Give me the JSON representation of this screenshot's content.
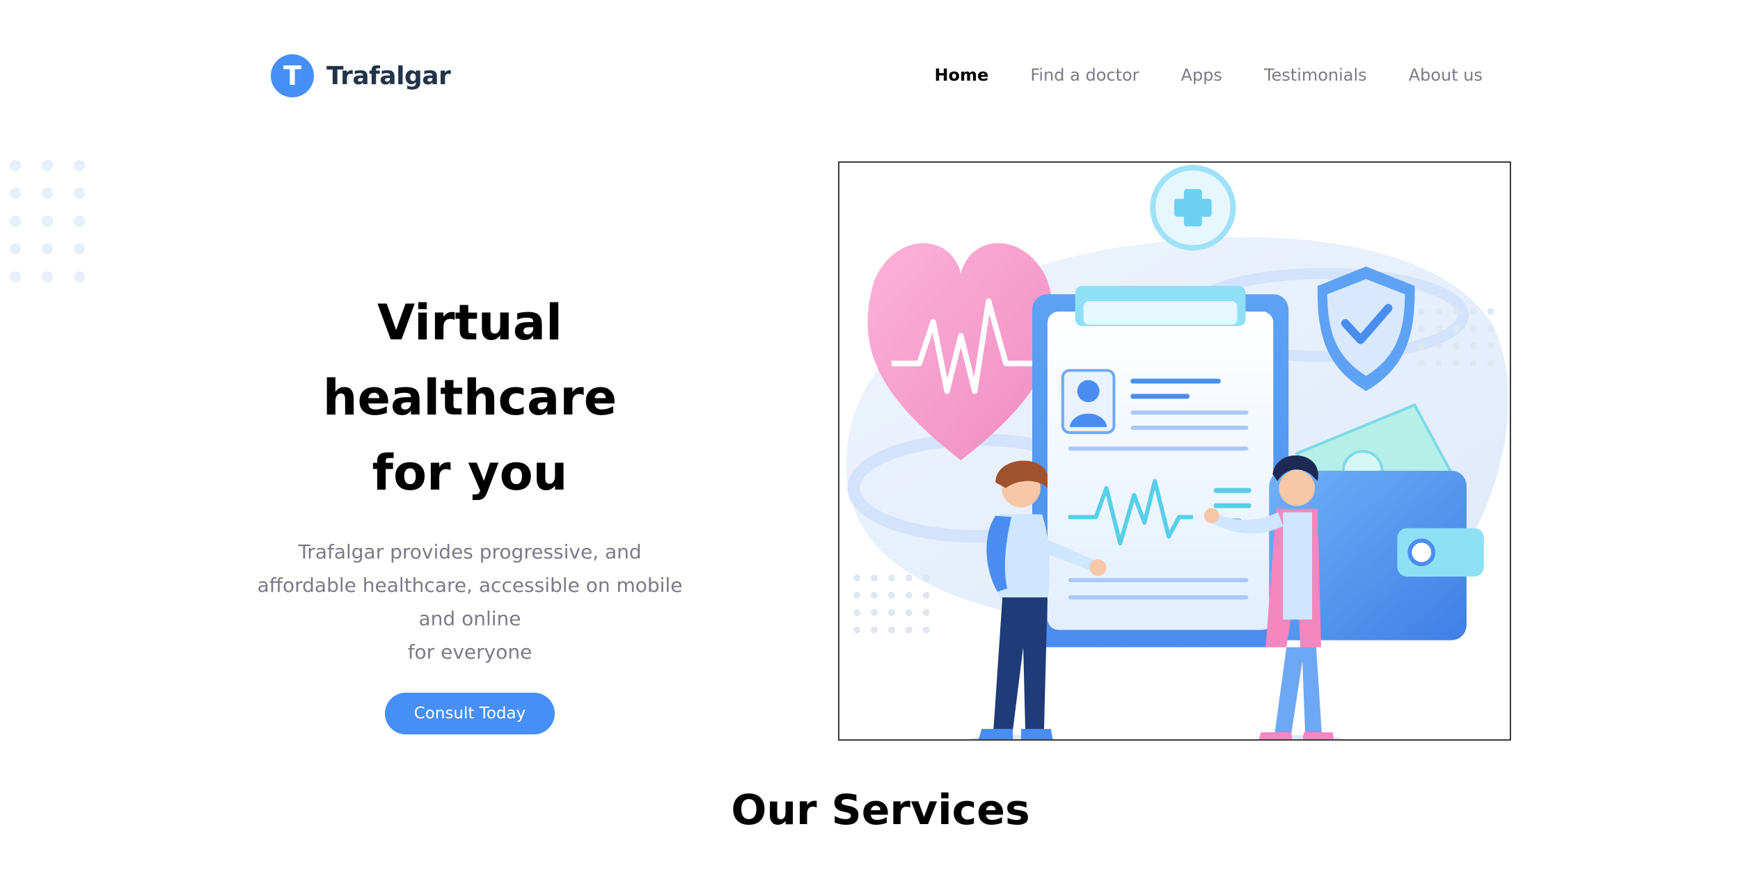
{
  "brand": {
    "logo_letter": "T",
    "name": "Trafalgar",
    "accent": "#458ff6"
  },
  "nav": {
    "items": [
      {
        "label": "Home",
        "active": true
      },
      {
        "label": "Find a doctor",
        "active": false
      },
      {
        "label": "Apps",
        "active": false
      },
      {
        "label": "Testimonials",
        "active": false
      },
      {
        "label": "About us",
        "active": false
      }
    ]
  },
  "hero": {
    "title_lines": [
      "Virtual",
      "healthcare",
      "for you"
    ],
    "description_lines": [
      "Trafalgar provides progressive, and",
      "affordable healthcare, accessible on mobile",
      "and online",
      "for everyone"
    ],
    "cta_label": "Consult Today"
  },
  "services": {
    "title": "Our Services"
  },
  "colors": {
    "heading": "#000000",
    "muted": "#7d7987",
    "brand_text": "#233348",
    "dot": "#e6effa"
  }
}
